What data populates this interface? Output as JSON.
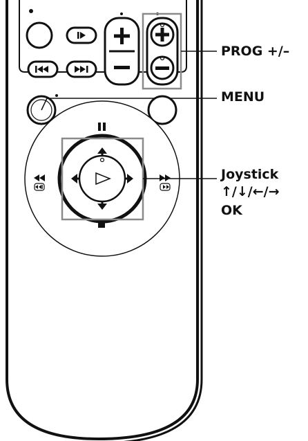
{
  "labels": {
    "prog": "PROG +/–",
    "menu": "MENU",
    "joystick": "Joystick",
    "arrows": "↑/↓/←/→",
    "ok": "OK"
  },
  "colors": {
    "outline": "#111111",
    "body": "#ffffff",
    "callout_box": "#8a8a8a",
    "label_text": "#111111"
  },
  "icons": {
    "play": "play-triangle-icon",
    "pause": "pause-icon",
    "stop": "stop-icon",
    "rewind": "rewind-icon",
    "fast_forward": "fast-forward-icon",
    "prev": "skip-back-icon",
    "next": "skip-forward-icon",
    "step": "step-play-icon"
  }
}
